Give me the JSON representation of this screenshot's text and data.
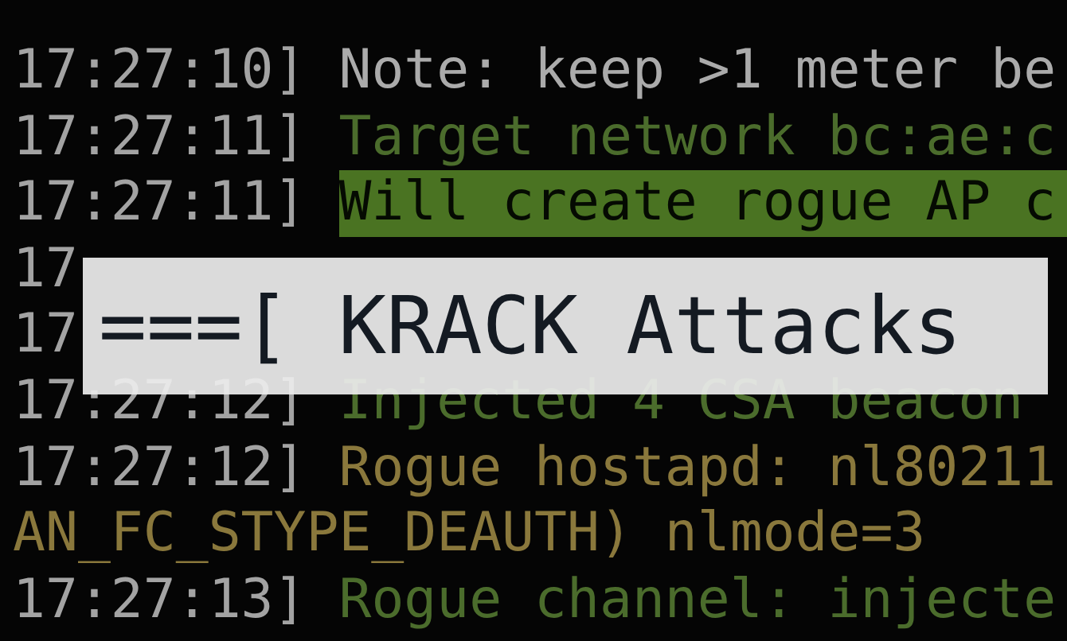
{
  "terminal": {
    "lines": [
      {
        "time": "17:27:10]",
        "message": "Note: keep >1 meter be",
        "kind": "note"
      },
      {
        "time": "17:27:11]",
        "message": "Target network bc:ae:c",
        "kind": "info"
      },
      {
        "time": "17:27:11]",
        "message": "Will create rogue AP c",
        "kind": "highlight"
      },
      {
        "time": "17"
      },
      {
        "time": "17"
      },
      {
        "time": "17:27:12]",
        "message": "Injected 4 CSA beacon",
        "kind": "info"
      },
      {
        "time": "17:27:12]",
        "message": "Rogue hostapd: nl80211",
        "kind": "warn"
      },
      {
        "message": "AN_FC_STYPE_DEAUTH) nlmode=3",
        "kind": "warn"
      },
      {
        "time": "17:27:13]",
        "message": "Rogue channel: injecte",
        "kind": "info"
      }
    ]
  },
  "banner": {
    "title": "===[ KRACK Attacks"
  }
}
